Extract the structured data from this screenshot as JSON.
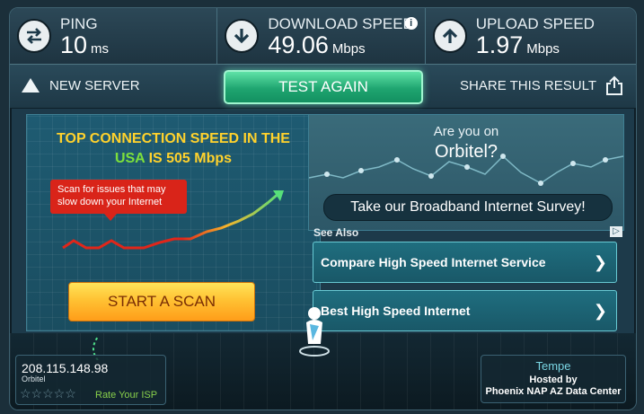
{
  "stats": {
    "ping": {
      "label": "PING",
      "value": "10",
      "unit": "ms"
    },
    "download": {
      "label": "DOWNLOAD SPEED",
      "value": "49.06",
      "unit": "Mbps"
    },
    "upload": {
      "label": "UPLOAD SPEED",
      "value": "1.97",
      "unit": "Mbps"
    }
  },
  "actions": {
    "new_server": "NEW SERVER",
    "test_again": "TEST AGAIN",
    "share": "SHARE THIS RESULT"
  },
  "promo": {
    "headline_1": "TOP CONNECTION SPEED IN THE",
    "headline_country": "USA",
    "headline_2": " IS 505 Mbps",
    "tip": "Scan for issues that may slow down your Internet",
    "scan_button": "START A SCAN"
  },
  "survey": {
    "question_1": "Are you on",
    "question_2": "Orbitel?",
    "button": "Take our Broadband Internet Survey!"
  },
  "ads": {
    "see_also": "See Also",
    "links": [
      {
        "label": "Compare High Speed Internet Service"
      },
      {
        "label": "Best High Speed Internet"
      }
    ]
  },
  "client": {
    "ip": "208.115.148.98",
    "isp": "Orbitel",
    "stars_text": "☆☆☆☆☆",
    "rate_label": "Rate Your ISP"
  },
  "server": {
    "city": "Tempe",
    "hosted_label": "Hosted by",
    "host": "Phoenix NAP AZ Data Center"
  },
  "colors": {
    "accent_green": "#1fa570",
    "headline_yellow": "#ffd22c",
    "country_green": "#7ce03b",
    "tip_red": "#d92419",
    "scan_orange": "#ffc233"
  },
  "icons": {
    "ping": "ping-arrows-icon",
    "download": "download-arrow-icon",
    "upload": "upload-arrow-icon",
    "info": "info-icon",
    "new_server": "triangle-icon",
    "share": "share-icon",
    "ad": "ad-choices-icon"
  }
}
